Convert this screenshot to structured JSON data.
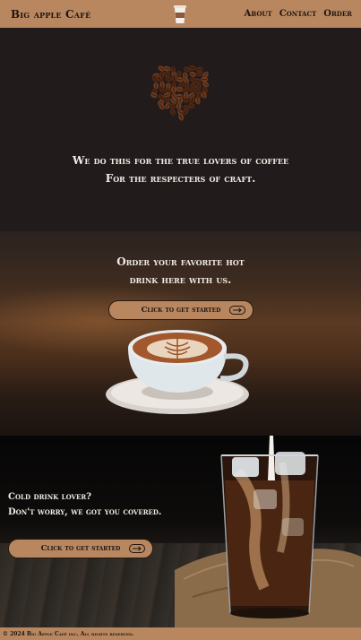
{
  "navbar": {
    "brand": "Big apple Café",
    "logo_icon": "coffee-cup-icon",
    "links": [
      "About",
      "Contact",
      "Order"
    ]
  },
  "hero": {
    "image": "coffee-bean-heart-icon",
    "line1": "We do this for the true lovers of coffee",
    "line2": "For the respecters of craft."
  },
  "hot_drinks": {
    "line1": "Order your favorite hot",
    "line2": "drink here with us.",
    "cta_label": "Click to get started",
    "cta_icon": "arrow-right-icon",
    "image": "latte-cup-image"
  },
  "cold_drinks": {
    "line1": "Cold drink lover?",
    "line2": "Don't worry, we got you covered.",
    "cta_label": "Click to get started",
    "cta_icon": "arrow-right-icon",
    "image": "iced-coffee-glass-image"
  },
  "footer": {
    "text": "© 2024 Big Apple Café inc. All rights reserved."
  },
  "colors": {
    "accent": "#b8875f",
    "dark": "#211b1a",
    "text_light": "#f2ece4"
  }
}
